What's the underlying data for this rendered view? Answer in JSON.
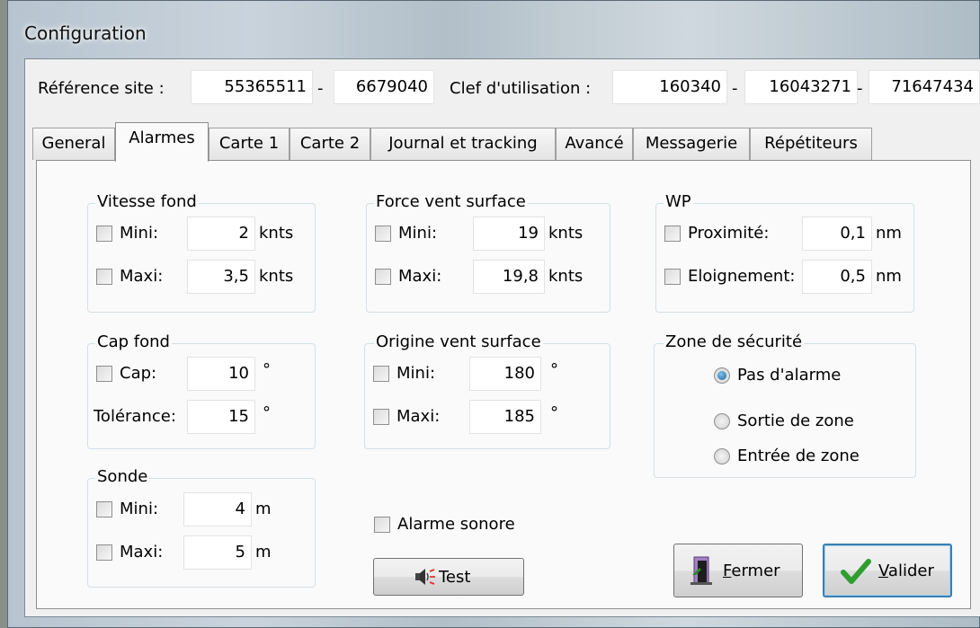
{
  "window": {
    "title": "Configuration"
  },
  "header": {
    "site_ref_label": "Référence site :",
    "site_ref_1": "55365511",
    "site_ref_sep": "-",
    "site_ref_2": "6679040",
    "key_label": "Clef d'utilisation :",
    "key_1": "160340",
    "key_sep_1": "-",
    "key_2": "16043271",
    "key_sep_2": "-",
    "key_3": "71647434"
  },
  "tabs": [
    "General",
    "Alarmes",
    "Carte 1",
    "Carte 2",
    "Journal et tracking",
    "Avancé",
    "Messagerie",
    "Répétiteurs"
  ],
  "active_tab": "Alarmes",
  "vitesse_fond": {
    "title": "Vitesse fond",
    "mini_label": "Mini:",
    "mini_value": "2",
    "mini_unit": "knts",
    "mini_checked": false,
    "maxi_label": "Maxi:",
    "maxi_value": "3,5",
    "maxi_unit": "knts",
    "maxi_checked": false
  },
  "force_vent": {
    "title": "Force vent surface",
    "mini_label": "Mini:",
    "mini_value": "19",
    "mini_unit": "knts",
    "mini_checked": false,
    "maxi_label": "Maxi:",
    "maxi_value": "19,8",
    "maxi_unit": "knts",
    "maxi_checked": false
  },
  "wp": {
    "title": "WP",
    "prox_label": "Proximité:",
    "prox_value": "0,1",
    "prox_unit": "nm",
    "prox_checked": false,
    "eloi_label": "Eloignement:",
    "eloi_value": "0,5",
    "eloi_unit": "nm",
    "eloi_checked": false
  },
  "cap_fond": {
    "title": "Cap fond",
    "cap_label": "Cap:",
    "cap_value": "10",
    "cap_unit": "°",
    "cap_checked": false,
    "tol_label": "Tolérance:",
    "tol_value": "15",
    "tol_unit": "°"
  },
  "origine_vent": {
    "title": "Origine vent surface",
    "mini_label": "Mini:",
    "mini_value": "180",
    "mini_unit": "°",
    "mini_checked": false,
    "maxi_label": "Maxi:",
    "maxi_value": "185",
    "maxi_unit": "°",
    "maxi_checked": false
  },
  "zone_securite": {
    "title": "Zone de sécurité",
    "options": [
      "Pas d'alarme",
      "Sortie de zone",
      "Entrée de zone"
    ],
    "selected": "Pas d'alarme"
  },
  "sonde": {
    "title": "Sonde",
    "mini_label": "Mini:",
    "mini_value": "4",
    "mini_unit": "m",
    "mini_checked": false,
    "maxi_label": "Maxi:",
    "maxi_value": "5",
    "maxi_unit": "m",
    "maxi_checked": false
  },
  "alarme_sonore": {
    "label": "Alarme sonore",
    "checked": false
  },
  "buttons": {
    "test_label": "Test",
    "fermer_hotkey": "F",
    "fermer_rest": "ermer",
    "valider_hotkey": "V",
    "valider_rest": "alider"
  },
  "colors": {
    "check_green": "#2f9e2f",
    "default_border": "#3c7fb1"
  }
}
